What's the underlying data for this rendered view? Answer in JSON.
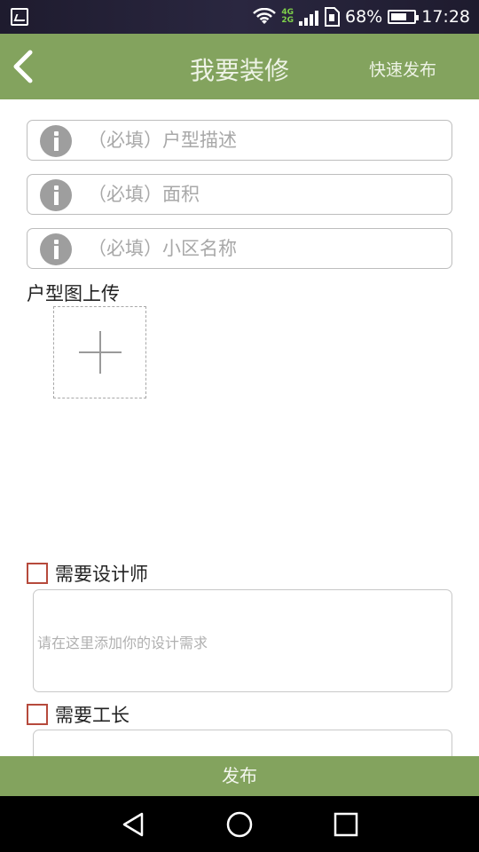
{
  "status_bar": {
    "network_label_top": "4G",
    "network_label_bottom": "2G",
    "battery_percent_text": "68%",
    "battery_level": 0.68,
    "time": "17:28"
  },
  "header": {
    "back_icon": "chevron-left-icon",
    "title": "我要装修",
    "action_label": "快速发布"
  },
  "form": {
    "fields": [
      {
        "placeholder": "（必填）户型描述",
        "icon": "info-icon",
        "value": ""
      },
      {
        "placeholder": "（必填）面积",
        "icon": "info-icon",
        "value": ""
      },
      {
        "placeholder": "（必填）小区名称",
        "icon": "info-icon",
        "value": ""
      }
    ],
    "upload_label": "户型图上传",
    "upload_icon": "plus-icon",
    "designer": {
      "label": "需要设计师",
      "checked": false,
      "placeholder": "请在这里添加你的设计需求"
    },
    "foreman": {
      "label": "需要工长",
      "checked": false
    }
  },
  "footer": {
    "publish_label": "发布"
  },
  "navigation": {
    "back": "triangle-back-icon",
    "home": "circle-home-icon",
    "recents": "square-recents-icon"
  },
  "colors": {
    "accent_green": "#83a35e",
    "checkbox_red": "#b64a3c"
  }
}
